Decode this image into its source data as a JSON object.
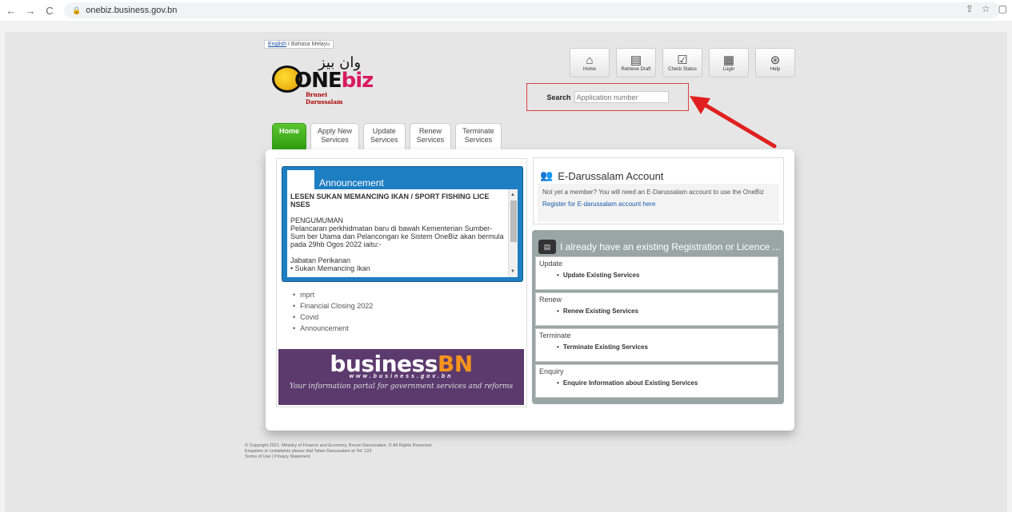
{
  "browser": {
    "url": "onebiz.business.gov.bn"
  },
  "language": {
    "english": "English",
    "separator": "I",
    "malay": "Bahasa Melayu"
  },
  "logo": {
    "arabic": "وان بيز",
    "word_one": "ONE",
    "word_biz": "biz",
    "sub": "Brunei Darussalam"
  },
  "toolbar": [
    {
      "label": "Home",
      "icon": "home-icon"
    },
    {
      "label": "Retrieve Draft",
      "icon": "draft-icon"
    },
    {
      "label": "Check Status",
      "icon": "status-icon"
    },
    {
      "label": "Login",
      "icon": "login-icon"
    },
    {
      "label": "Help",
      "icon": "help-icon"
    }
  ],
  "search": {
    "label": "Search",
    "placeholder": "Application number"
  },
  "tabs": [
    {
      "line1": "Home",
      "line2": ""
    },
    {
      "line1": "Apply New",
      "line2": "Services"
    },
    {
      "line1": "Update",
      "line2": "Services"
    },
    {
      "line1": "Renew",
      "line2": "Services"
    },
    {
      "line1": "Terminate",
      "line2": "Services"
    }
  ],
  "announcement": {
    "heading": "Announcement",
    "title": "LESEN SUKAN MEMANCING IKAN / SPORT FISHING LICE NSES",
    "subheading": "PENGUMUMAN",
    "paragraph": "Pelancaran perkhidmatan baru di bawah Kementerian Sumber-Sum ber Utama dan Pelancongan ke Sistem OneBiz akan bermula pada 29hb Ogos 2022 iaitu:-",
    "line1": "Jabatan Perikanan",
    "line2": "• Sukan Memancing Ikan"
  },
  "links": [
    "mprt",
    "Financial Closing 2022",
    "Covid",
    "Announcement"
  ],
  "banner": {
    "brand_a": "business",
    "brand_b": "BN",
    "url": "www.business.gov.bn",
    "tagline": "Your information portal for government services and reforms"
  },
  "edarussalam": {
    "title": "E-Darussalam Account",
    "text": "Not yet a member? You will need an E-Darussalam account to use the OneBiz",
    "link": "Register for E-darussalam account here"
  },
  "existing": {
    "title": "I already have an existing Registration or Licence ...",
    "sections": [
      {
        "name": "Update",
        "item": "Update Existing Services"
      },
      {
        "name": "Renew",
        "item": "Renew Existing Services"
      },
      {
        "name": "Terminate",
        "item": "Terminate Existing Services"
      },
      {
        "name": "Enquiry",
        "item": "Enquire Information about Existing Services"
      }
    ]
  },
  "footer": {
    "copyright": "© Copyright 2021. Ministry of Finance and Economy, Brunei Darussalam. © All Rights Reserved.",
    "enquiries": "Enquiries or complaints please dial Talian Darussalam at Tel: 123",
    "terms": "Terms of Use",
    "separator": "|",
    "privacy": "Privacy Statement"
  },
  "colors": {
    "accent_green": "#3fae1e",
    "announce_blue": "#1e7ec2",
    "banner_purple": "#5c3a6e",
    "highlight_red": "#d94040"
  }
}
